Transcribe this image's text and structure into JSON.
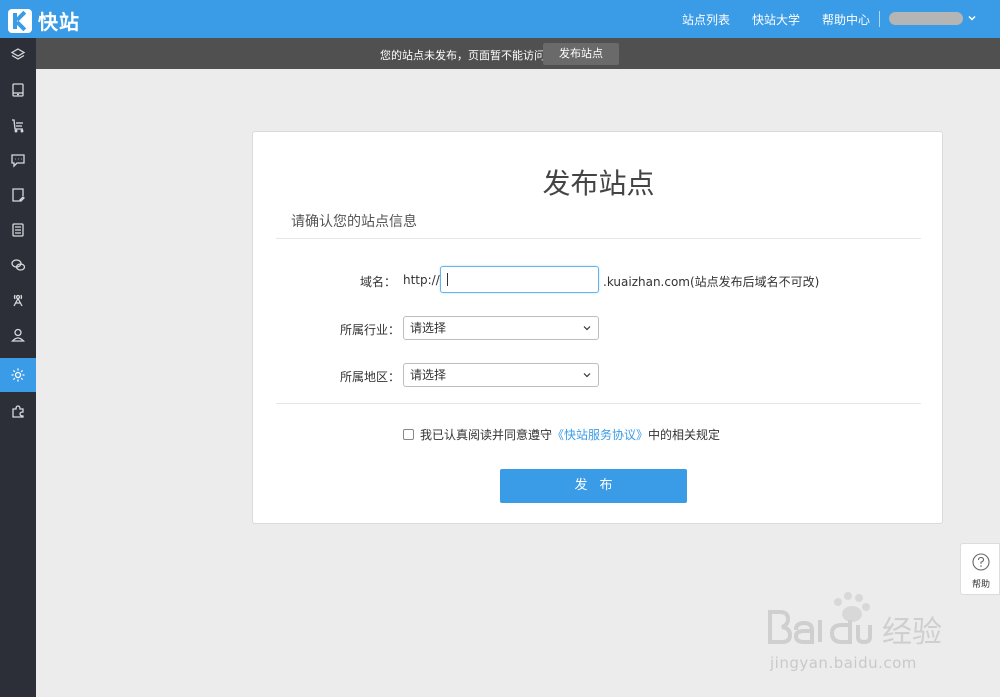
{
  "header": {
    "logo_text": "快站",
    "nav": [
      "站点列表",
      "快站大学",
      "帮助中心"
    ]
  },
  "sidebar": {
    "active_index": 9,
    "items": [
      "layers-icon",
      "tablet-icon",
      "cart-icon",
      "chat-icon",
      "doc-edit-icon",
      "list-icon",
      "wechat-icon",
      "broadcast-tower-icon",
      "user-icon",
      "gear-icon",
      "puzzle-icon"
    ]
  },
  "notice": {
    "text": "您的站点未发布，页面暂不能访问。",
    "button": "发布站点"
  },
  "form": {
    "title": "发布站点",
    "subtitle": "请确认您的站点信息",
    "domain_label": "域名：",
    "domain_prefix": "http://",
    "domain_value": "",
    "domain_suffix": ".kuaizhan.com(站点发布后域名不可改)",
    "industry_label": "所属行业：",
    "industry_value": "请选择",
    "region_label": "所属地区：",
    "region_value": "请选择",
    "agree_before": "我已认真阅读并同意遵守",
    "agree_link": "《快站服务协议》",
    "agree_after": "中的相关规定",
    "agree_checked": false,
    "submit_label": "发布"
  },
  "help": {
    "label": "帮助"
  },
  "watermark": {
    "text": "jingyan.baidu.com"
  },
  "colors": {
    "brand": "#3a9be6",
    "sidebar": "#2c2f38",
    "notice": "#505050"
  }
}
